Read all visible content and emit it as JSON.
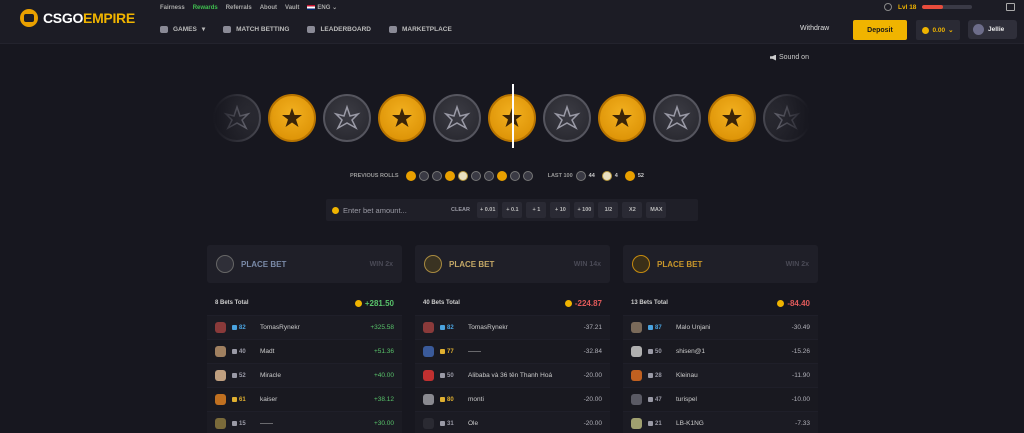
{
  "brand": {
    "part1": "CSGO",
    "part2": "EMPIRE"
  },
  "top_links": [
    "Fairness",
    "Rewards",
    "Referrals",
    "About",
    "Vault"
  ],
  "top_links_active": "Rewards",
  "language": "ENG",
  "main_nav": [
    "GAMES",
    "MATCH BETTING",
    "LEADERBOARD",
    "MARKETPLACE"
  ],
  "level": {
    "label": "Lvl 18",
    "progress": 0.42
  },
  "header_actions": {
    "withdraw": "Withdraw",
    "deposit": "Deposit",
    "balance": "0.00",
    "username": "Jellie"
  },
  "sound_label": "Sound on",
  "roll_strip": [
    "ct",
    "t",
    "ct",
    "t",
    "ct",
    "t",
    "ct",
    "t",
    "ct",
    "t",
    "ct",
    "t"
  ],
  "previous_rolls": {
    "label": "PREVIOUS ROLLS",
    "items": [
      "t",
      "ct",
      "ct",
      "t",
      "bonus",
      "ct",
      "ct",
      "t",
      "ct",
      "ct"
    ]
  },
  "last100": {
    "label": "LAST 100",
    "ct": "44",
    "bonus": "4",
    "t": "52"
  },
  "bet_controls": {
    "placeholder": "Enter bet amount...",
    "clear": "CLEAR",
    "buttons": [
      "+ 0.01",
      "+ 0.1",
      "+ 1",
      "+ 10",
      "+ 100",
      "1/2",
      "X2",
      "MAX"
    ]
  },
  "columns": [
    {
      "type": "ct",
      "place": "PLACE BET",
      "win": "WIN 2x",
      "total_label": "8 Bets Total",
      "total": "+281.50",
      "total_sign": "pos",
      "rows": [
        {
          "level": "82",
          "level_color": "#4aa3df",
          "name": "TomasRynekr",
          "amount": "+325.58",
          "sign": "pos",
          "avatar": "#8a3a3a"
        },
        {
          "level": "40",
          "level_color": "#9a9aa6",
          "name": "Madt",
          "amount": "+51.36",
          "sign": "pos",
          "avatar": "#a08060"
        },
        {
          "level": "52",
          "level_color": "#9a9aa6",
          "name": "Miracle",
          "amount": "+40.00",
          "sign": "pos",
          "avatar": "#c0a080"
        },
        {
          "level": "61",
          "level_color": "#e0b030",
          "name": "kaiser",
          "amount": "+38.12",
          "sign": "pos",
          "avatar": "#c07020"
        },
        {
          "level": "15",
          "level_color": "#9a9aa6",
          "name": "——",
          "amount": "+30.00",
          "sign": "pos",
          "avatar": "#7a6a3a"
        }
      ]
    },
    {
      "type": "bonus",
      "place": "PLACE BET",
      "win": "WIN 14x",
      "total_label": "40 Bets Total",
      "total": "-224.87",
      "total_sign": "neg",
      "rows": [
        {
          "level": "82",
          "level_color": "#4aa3df",
          "name": "TomasRynekr",
          "amount": "-37.21",
          "sign": "neg",
          "avatar": "#8a3a3a"
        },
        {
          "level": "77",
          "level_color": "#e0b030",
          "name": "——",
          "amount": "-32.84",
          "sign": "neg",
          "avatar": "#3a5a9a"
        },
        {
          "level": "50",
          "level_color": "#9a9aa6",
          "name": "Alibaba và 36 tên Thanh Hoá",
          "amount": "-20.00",
          "sign": "neg",
          "avatar": "#c03030"
        },
        {
          "level": "80",
          "level_color": "#e0b030",
          "name": "monti",
          "amount": "-20.00",
          "sign": "neg",
          "avatar": "#8a8a90"
        },
        {
          "level": "31",
          "level_color": "#9a9aa6",
          "name": "Ole",
          "amount": "-20.00",
          "sign": "neg",
          "avatar": "#2a2a32"
        }
      ]
    },
    {
      "type": "t",
      "place": "PLACE BET",
      "win": "WIN 2x",
      "total_label": "13 Bets Total",
      "total": "-84.40",
      "total_sign": "neg",
      "rows": [
        {
          "level": "87",
          "level_color": "#4aa3df",
          "name": "Malo Unjani",
          "amount": "-30.49",
          "sign": "neg",
          "avatar": "#7a6a5a"
        },
        {
          "level": "50",
          "level_color": "#9a9aa6",
          "name": "shisen@1",
          "amount": "-15.26",
          "sign": "neg",
          "avatar": "#b0b0b0"
        },
        {
          "level": "28",
          "level_color": "#9a9aa6",
          "name": "Kleinau",
          "amount": "-11.90",
          "sign": "neg",
          "avatar": "#c06020"
        },
        {
          "level": "47",
          "level_color": "#9a9aa6",
          "name": "turispel",
          "amount": "-10.00",
          "sign": "neg",
          "avatar": "#5a5a64"
        },
        {
          "level": "21",
          "level_color": "#9a9aa6",
          "name": "LB-K1NG",
          "amount": "-7.33",
          "sign": "neg",
          "avatar": "#a0a070"
        }
      ]
    }
  ],
  "colors": {
    "accent": "#f0b400",
    "positive": "#58c26a",
    "negative": "#e05a5a",
    "background": "#17171f"
  }
}
